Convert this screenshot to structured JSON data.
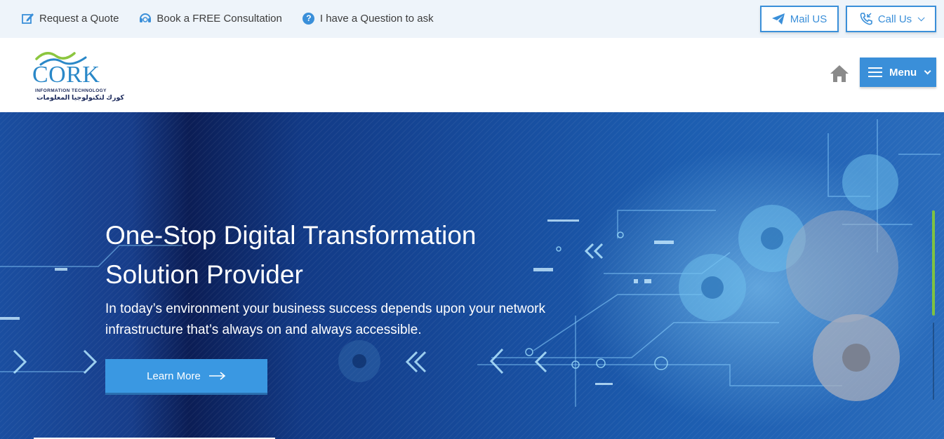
{
  "topbar": {
    "links": [
      {
        "label": "Request a Quote",
        "icon": "edit-icon"
      },
      {
        "label": "Book a FREE Consultation",
        "icon": "headset-icon"
      },
      {
        "label": "I have a Question to ask",
        "icon": "question-icon"
      }
    ],
    "question_glyph": "?",
    "mail_label": "Mail US",
    "call_label": "Call Us"
  },
  "header": {
    "logo": {
      "word": "CORK",
      "subtitle": "INFORMATION TECHNOLOGY",
      "arabic": "كورك لتكنولوجيا المعلومات"
    },
    "menu_label": "Menu"
  },
  "hero": {
    "title_line1": "One-Stop Digital Transformation",
    "title_line2": "Solution Provider",
    "subtitle": "In today’s environment your business success depends upon your network infrastructure that’s always on and always accessible.",
    "cta_label": "Learn More"
  },
  "colors": {
    "accent": "#3a8fd9",
    "topbar_bg": "#eef4fa",
    "hero_dark": "#0b1d55",
    "hero_light": "#2a6cbc",
    "scroll_indicator": "#7fc240"
  }
}
